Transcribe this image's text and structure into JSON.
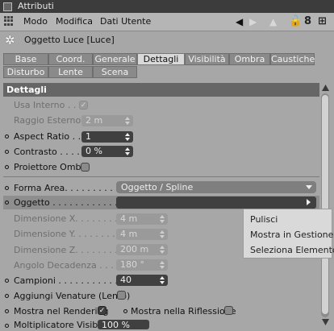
{
  "titlebar": {
    "title": "Attributi"
  },
  "menubar": {
    "items": [
      "Modo",
      "Modifica",
      "Dati Utente"
    ],
    "icons": [
      "back-arrow-icon",
      "forward-arrow-icon",
      "up-arrow-icon",
      "lock-icon",
      "numbered-8-icon",
      "add-view-icon"
    ]
  },
  "object": {
    "name": "Oggetto Luce [Luce]",
    "icon": "light-object-icon"
  },
  "tabs": {
    "row1": [
      "Base",
      "Coord.",
      "Generale",
      "Dettagli",
      "Visibilità",
      "Ombra",
      "Caustiche"
    ],
    "row2": [
      "Disturbo",
      "Lente",
      "Scena"
    ],
    "active": "Dettagli"
  },
  "section": {
    "title": "Dettagli"
  },
  "fields": {
    "usa_interno": {
      "label": "Usa Interno . . .",
      "checked": true
    },
    "raggio_esterno": {
      "label": "Raggio Esterno",
      "value": "2 m"
    },
    "aspect_ratio": {
      "label": "Aspect Ratio . .",
      "value": "1"
    },
    "contrasto": {
      "label": "Contrasto . . . . .",
      "value": "0 %"
    },
    "proiettore_ombre": {
      "label": "Proiettore Ombre",
      "checked": false
    },
    "forma_area": {
      "label": "Forma Area. . . . . . . . . . .",
      "value": "Oggetto / Spline"
    },
    "oggetto": {
      "label": "Oggetto . . . . . . . . . . . . ."
    },
    "dimensione_x": {
      "label": "Dimensione X. . . . . . . .",
      "value": "4 m"
    },
    "dimensione_y": {
      "label": "Dimensione Y. . . . . . . .",
      "value": "4 m"
    },
    "dimensione_z": {
      "label": "Dimensione Z. . . . . . . .",
      "value": "200 m"
    },
    "angolo_decadenza": {
      "label": "Angolo Decadenza . . .",
      "value": "180 °"
    },
    "campioni": {
      "label": "Campioni . . . . . . . . . . . .",
      "value": "40"
    },
    "aggiungi_venature": {
      "label": "Aggiungi Venature (Lento)",
      "checked": false
    },
    "mostra_rendering": {
      "label": "Mostra nel Rendering",
      "checked": true
    },
    "mostra_riflessione": {
      "label": "Mostra nella Riflessione",
      "checked": false
    },
    "moltiplicatore": {
      "label": "Moltiplicatore Visibilità",
      "value": "100 %"
    }
  },
  "context_menu": {
    "items": [
      "Pulisci",
      "Mostra in Gestione",
      "Seleziona Elemento"
    ]
  },
  "colors": {
    "field_bg": "#404040",
    "panel_bg": "#a7a7a7",
    "section_bg": "#666666",
    "active_tab_bg": "#d9d9d9"
  }
}
